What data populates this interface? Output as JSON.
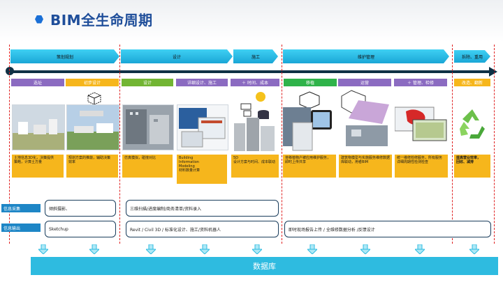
{
  "title": "BIM全生命周期",
  "phases": [
    {
      "label": "策划规划"
    },
    {
      "label": "设计"
    },
    {
      "label": "施工"
    },
    {
      "label": "维护管理"
    },
    {
      "label": "拆除、重用"
    }
  ],
  "stages": [
    {
      "label": "选址",
      "color": "#8b6bc1",
      "desc": "土地信息3D化，决策提供\n策略，计算土方量"
    },
    {
      "label": "初步设计",
      "color": "#f6b61c",
      "desc": "规划方案的推敲，辅助决策\n效率"
    },
    {
      "label": "设计",
      "color": "#72b533",
      "desc": "仿真模拟，碰撞对比"
    },
    {
      "label": "详细设计、施工",
      "color": "#8b6bc1",
      "desc": "Building\n        Information\n          Modeling\n        材料数量计算"
    },
    {
      "label": "＋ 时间、成本",
      "color": "#8b6bc1",
      "desc": "5D\n设计方案与时间、成本联动"
    },
    {
      "label": "移植",
      "color": "#2fb34a",
      "desc": "将移植物户被应用维护服务，\n即时上传共享"
    },
    {
      "label": "运营",
      "color": "#8b6bc1",
      "desc": "建筑物模型与实施服务维修数据\n库联动，用者BIM"
    },
    {
      "label": "＋ 管理、检修",
      "color": "#8b6bc1",
      "desc": "统一维修检修服务，所有服务\n详细周期性检测检查"
    },
    {
      "label": "改造、翻新",
      "color": "#f6b61c",
      "desc": "提高营业效率，\n回收、减排"
    }
  ],
  "side_labels": {
    "collect": "信息采集",
    "output": "信息输出"
  },
  "bubbles": {
    "collect_1": "倾斜摄影、",
    "collect_2": "三维扫描/进度编制/商务清单/资料录入",
    "output_1": "Sketchup",
    "output_2": "Revit / Civil 3D / 标准化设计、施工/资料机器人",
    "output_3": "即时现场报告上传 / 全维修数据分析 /反馈设计"
  },
  "database": "数据库",
  "colors": {
    "accent": "#1a6fd6",
    "phase": "#1aa6d6",
    "divider": "#e02020",
    "database": "#2ebbe0"
  }
}
